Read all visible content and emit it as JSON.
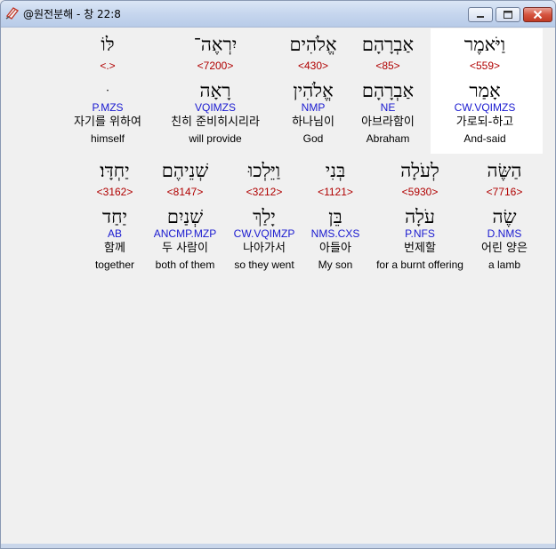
{
  "window": {
    "title": "@원전분해 - 창 22:8"
  },
  "colors": {
    "strong": "#b00000",
    "morph": "#1a1ad0",
    "highlight_bg": "#ffffff"
  },
  "words": [
    {
      "heb": "וַיֹּאמֶר",
      "strong": "<559>",
      "lemma": "אָמַר",
      "morph": "CW.VQIMZS",
      "kor": "가로되-하고",
      "eng": "And-said",
      "selected": true
    },
    {
      "heb": "אַבְרָהָם",
      "strong": "<85>",
      "lemma": "אַבְרָהָם",
      "morph": "NE",
      "kor": "아브라함이",
      "eng": "Abraham"
    },
    {
      "heb": "אֱלֹהִים",
      "strong": "<430>",
      "lemma": "אֱלֹהִין",
      "morph": "NMP",
      "kor": "하나님이",
      "eng": "God"
    },
    {
      "heb": "יִרְאֶה־",
      "strong": "<7200>",
      "lemma": "רָאָה",
      "morph": "VQIMZS",
      "kor": "친히 준비히시리라",
      "eng": "will provide"
    },
    {
      "heb": "לּוֹ",
      "strong": "<.>",
      "lemma": "ּ",
      "morph": "P.MZS",
      "kor": "자기를 위하여",
      "eng": "himself"
    },
    {
      "heb": "הַשֶּׂה",
      "strong": "<7716>",
      "lemma": "שֶׂה",
      "morph": "D.NMS",
      "kor": "어린 양은",
      "eng": "a lamb"
    },
    {
      "heb": "לְעֹלָה",
      "strong": "<5930>",
      "lemma": "עֹלָה",
      "morph": "P.NFS",
      "kor": "번제할",
      "eng": "for a burnt offering"
    },
    {
      "heb": "בְּנִי",
      "strong": "<1121>",
      "lemma": "בֵּן",
      "morph": "NMS.CXS",
      "kor": "아들아",
      "eng": "My son"
    },
    {
      "heb": "וַיֵּלְכוּ",
      "strong": "<3212>",
      "lemma": "יָלַךְ",
      "morph": "CW.VQIMZP",
      "kor": "나아가서",
      "eng": "so they went"
    },
    {
      "heb": "שְׁנֵיהֶם",
      "strong": "<8147>",
      "lemma": "שְׁנַיִם",
      "morph": "ANCMP.MZP",
      "kor": "두 사람이",
      "eng": "both of them"
    },
    {
      "heb": "יַחְדָּו׃",
      "strong": "<3162>",
      "lemma": "יַחַד",
      "morph": "AB",
      "kor": "함께",
      "eng": "together"
    }
  ]
}
